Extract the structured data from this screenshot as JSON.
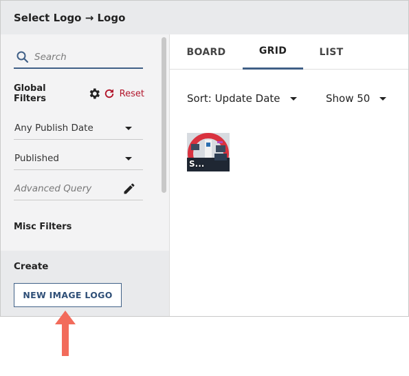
{
  "dialog": {
    "title": "Select Logo → Logo"
  },
  "sidebar": {
    "search": {
      "placeholder": "Search"
    },
    "global_filters": {
      "title": "Global Filters",
      "reset_label": "Reset"
    },
    "filters": [
      {
        "label": "Any Publish Date"
      },
      {
        "label": "Published"
      },
      {
        "label": "Advanced Query"
      }
    ],
    "misc_filters_title": "Misc Filters",
    "create": {
      "title": "Create",
      "button_label": "NEW IMAGE LOGO"
    }
  },
  "main": {
    "tabs": [
      {
        "label": "BOARD",
        "active": false
      },
      {
        "label": "GRID",
        "active": true
      },
      {
        "label": "LIST",
        "active": false
      }
    ],
    "sort": {
      "label": "Sort: Update Date"
    },
    "show": {
      "label": "Show 50"
    },
    "items": [
      {
        "label": "S..."
      }
    ]
  },
  "colors": {
    "accent": "#3f5f86",
    "reset": "#b2162b",
    "arrow": "#f26b5b"
  }
}
